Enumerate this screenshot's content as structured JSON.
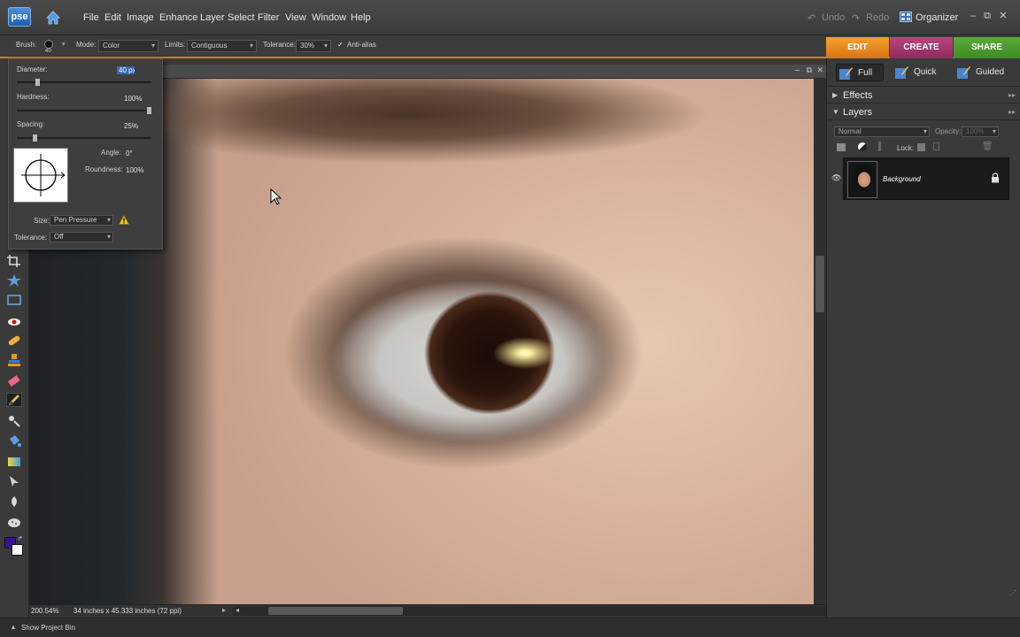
{
  "app": {
    "logo": "pse"
  },
  "menu": [
    "File",
    "Edit",
    "Image",
    "Enhance",
    "Layer",
    "Select",
    "Filter",
    "View",
    "Window",
    "Help"
  ],
  "top_right": {
    "undo": "Undo",
    "redo": "Redo",
    "organizer": "Organizer"
  },
  "options_bar": {
    "brush_label": "Brush:",
    "brush_size": "40",
    "mode_label": "Mode:",
    "mode_value": "Color",
    "limits_label": "Limits:",
    "limits_value": "Contiguous",
    "tolerance_label": "Tolerance:",
    "tolerance_value": "30%",
    "antialias_label": "Anti-alias",
    "antialias_checked": true
  },
  "mode_tabs": {
    "edit": "EDIT",
    "create": "CREATE",
    "share": "SHARE"
  },
  "brush_panel": {
    "diameter_label": "Diameter:",
    "diameter_value": "40 px",
    "hardness_label": "Hardness:",
    "hardness_value": "100%",
    "spacing_label": "Spacing:",
    "spacing_value": "25%",
    "angle_label": "Angle:",
    "angle_value": "0°",
    "roundness_label": "Roundness:",
    "roundness_value": "100%",
    "size_label": "Size:",
    "size_value": "Pen Pressure",
    "tolerance_label": "Tolerance:",
    "tolerance_value": "Off",
    "diameter_level": 0.14,
    "hardness_level": 1.0,
    "spacing_level": 0.12
  },
  "view_modes": {
    "full": "Full",
    "quick": "Quick",
    "guided": "Guided"
  },
  "panels": {
    "effects": "Effects",
    "layers": "Layers",
    "blend_mode": "Normal",
    "opacity_label": "Opacity:",
    "opacity_value": "100%",
    "lock_label": "Lock:",
    "layer_name": "Background"
  },
  "status": {
    "zoom": "200.54%",
    "doc_size": "34 inches x 45.333 inches (72 ppi)"
  },
  "bottom": {
    "project_bin": "Show Project Bin"
  },
  "colors": {
    "accent_edit": "#e8891f",
    "accent_create": "#a63a70",
    "accent_share": "#4c9a2f",
    "foreground_swatch": "#3a0f9e",
    "background_swatch": "#ffffff"
  }
}
